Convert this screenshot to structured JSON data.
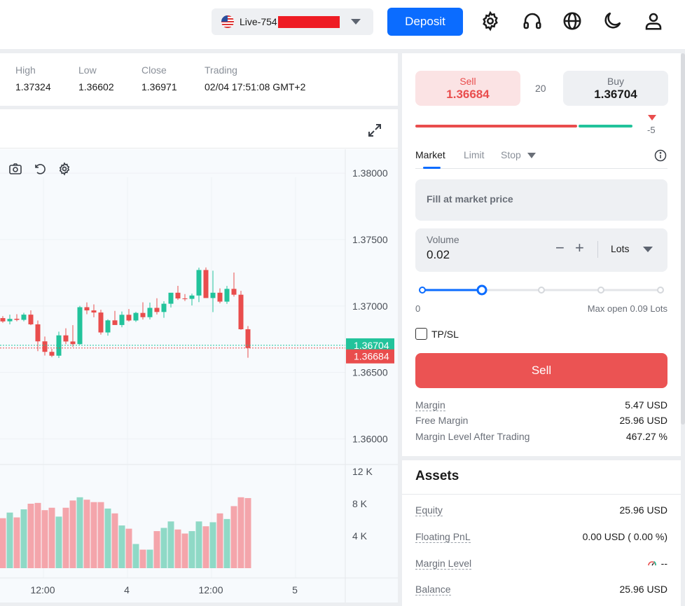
{
  "header": {
    "account_label": "Live-754",
    "deposit_label": "Deposit",
    "icons": [
      "gear-icon",
      "headset-icon",
      "globe-icon",
      "moon-icon",
      "user-icon"
    ]
  },
  "stats": [
    {
      "label": "High",
      "value": "1.37324"
    },
    {
      "label": "Low",
      "value": "1.36602"
    },
    {
      "label": "Close",
      "value": "1.36971"
    },
    {
      "label": "Trading",
      "value": "02/04 17:51:08 GMT+2"
    }
  ],
  "chart": {
    "price_ticks": [
      "1.38000",
      "1.37500",
      "1.37000",
      "1.36500",
      "1.36000"
    ],
    "volume_ticks": [
      "12 K",
      "8 K",
      "4 K"
    ],
    "x_ticks": [
      "12:00",
      "4",
      "12:00",
      "5"
    ],
    "ask_label": "1.36704",
    "bid_label": "1.36684",
    "colors": {
      "up": "#22c39b",
      "down": "#e94d4d",
      "up_volume": "#8fd9c6",
      "down_volume": "#f4a5ab"
    }
  },
  "chart_data": {
    "type": "candlestick",
    "ylim": [
      1.3586,
      1.3818
    ],
    "volume_ylim": [
      0,
      12000
    ],
    "candles": [
      {
        "o": 1.36891,
        "h": 1.36954,
        "l": 1.36868,
        "c": 1.36908
      },
      {
        "o": 1.36909,
        "h": 1.36924,
        "l": 1.36874,
        "c": 1.36884
      },
      {
        "o": 1.36885,
        "h": 1.36935,
        "l": 1.36862,
        "c": 1.36903
      },
      {
        "o": 1.36904,
        "h": 1.36938,
        "l": 1.36885,
        "c": 1.36896
      },
      {
        "o": 1.36896,
        "h": 1.36949,
        "l": 1.36885,
        "c": 1.36935
      },
      {
        "o": 1.36935,
        "h": 1.36967,
        "l": 1.36856,
        "c": 1.36862
      },
      {
        "o": 1.36862,
        "h": 1.36891,
        "l": 1.3666,
        "c": 1.36734
      },
      {
        "o": 1.36734,
        "h": 1.3677,
        "l": 1.36627,
        "c": 1.36655
      },
      {
        "o": 1.36655,
        "h": 1.36677,
        "l": 1.36615,
        "c": 1.36626
      },
      {
        "o": 1.36626,
        "h": 1.36807,
        "l": 1.36609,
        "c": 1.36779
      },
      {
        "o": 1.36779,
        "h": 1.36832,
        "l": 1.36713,
        "c": 1.36733
      },
      {
        "o": 1.36733,
        "h": 1.36856,
        "l": 1.36692,
        "c": 1.36713
      },
      {
        "o": 1.36713,
        "h": 1.37001,
        "l": 1.36709,
        "c": 1.36991
      },
      {
        "o": 1.36991,
        "h": 1.37027,
        "l": 1.36938,
        "c": 1.36967
      },
      {
        "o": 1.36967,
        "h": 1.37012,
        "l": 1.36915,
        "c": 1.36951
      },
      {
        "o": 1.36951,
        "h": 1.36972,
        "l": 1.36785,
        "c": 1.36801
      },
      {
        "o": 1.36801,
        "h": 1.369,
        "l": 1.36777,
        "c": 1.36892
      },
      {
        "o": 1.36892,
        "h": 1.36963,
        "l": 1.36859,
        "c": 1.36857
      },
      {
        "o": 1.36857,
        "h": 1.36959,
        "l": 1.3684,
        "c": 1.36934
      },
      {
        "o": 1.36934,
        "h": 1.36977,
        "l": 1.36883,
        "c": 1.36891
      },
      {
        "o": 1.36891,
        "h": 1.36956,
        "l": 1.3688,
        "c": 1.36948
      },
      {
        "o": 1.36948,
        "h": 1.37028,
        "l": 1.36898,
        "c": 1.36916
      },
      {
        "o": 1.36916,
        "h": 1.37026,
        "l": 1.36899,
        "c": 1.36986
      },
      {
        "o": 1.36986,
        "h": 1.37058,
        "l": 1.36936,
        "c": 1.36955
      },
      {
        "o": 1.36955,
        "h": 1.37036,
        "l": 1.36911,
        "c": 1.37017
      },
      {
        "o": 1.37017,
        "h": 1.37093,
        "l": 1.36989,
        "c": 1.371
      },
      {
        "o": 1.371,
        "h": 1.37152,
        "l": 1.37046,
        "c": 1.37057
      },
      {
        "o": 1.37057,
        "h": 1.3709,
        "l": 1.37038,
        "c": 1.37054
      },
      {
        "o": 1.37054,
        "h": 1.37093,
        "l": 1.37004,
        "c": 1.37079
      },
      {
        "o": 1.37079,
        "h": 1.37289,
        "l": 1.37029,
        "c": 1.37271
      },
      {
        "o": 1.37271,
        "h": 1.3729,
        "l": 1.371,
        "c": 1.3706
      },
      {
        "o": 1.3706,
        "h": 1.37266,
        "l": 1.36954,
        "c": 1.371
      },
      {
        "o": 1.371,
        "h": 1.37133,
        "l": 1.3702,
        "c": 1.37033
      },
      {
        "o": 1.37033,
        "h": 1.37151,
        "l": 1.37016,
        "c": 1.37129
      },
      {
        "o": 1.37129,
        "h": 1.37252,
        "l": 1.37071,
        "c": 1.37085
      },
      {
        "o": 1.37085,
        "h": 1.37114,
        "l": 1.36821,
        "c": 1.36825
      },
      {
        "o": 1.36825,
        "h": 1.36849,
        "l": 1.36611,
        "c": 1.36684
      }
    ],
    "volume": [
      5800,
      6200,
      6900,
      6300,
      7300,
      8000,
      8100,
      7200,
      7500,
      6400,
      7500,
      8400,
      8800,
      8500,
      8200,
      8200,
      7400,
      6800,
      5300,
      4900,
      3000,
      2300,
      2300,
      4600,
      5000,
      5800,
      4800,
      4300,
      4600,
      5800,
      5200,
      5700,
      6800,
      6100,
      7700,
      8800,
      8700
    ]
  },
  "order": {
    "sell_label": "Sell",
    "sell_price": "1.36684",
    "spread": "20",
    "buy_label": "Buy",
    "buy_price": "1.36704",
    "change": "-5",
    "tabs": [
      "Market",
      "Limit",
      "Stop"
    ],
    "fill_text": "Fill at market price",
    "volume_label": "Volume",
    "volume_value": "0.02",
    "unit": "Lots",
    "slider_min": "0",
    "slider_max": "Max open 0.09 Lots",
    "slider_fraction": 0.25,
    "tpsl_label": "TP/SL",
    "sell_button": "Sell"
  },
  "margins": [
    {
      "label": "Margin",
      "value": "5.47 USD"
    },
    {
      "label": "Free Margin",
      "value": "25.96 USD"
    },
    {
      "label": "Margin Level After Trading",
      "value": "467.27 %"
    }
  ],
  "assets": {
    "title": "Assets",
    "rows": [
      {
        "label": "Equity",
        "value": "25.96 USD"
      },
      {
        "label": "Floating PnL",
        "value": "0.00 USD ( 0.00 %)"
      },
      {
        "label": "Margin Level",
        "value": "--"
      },
      {
        "label": "Balance",
        "value": "25.96 USD"
      }
    ]
  }
}
